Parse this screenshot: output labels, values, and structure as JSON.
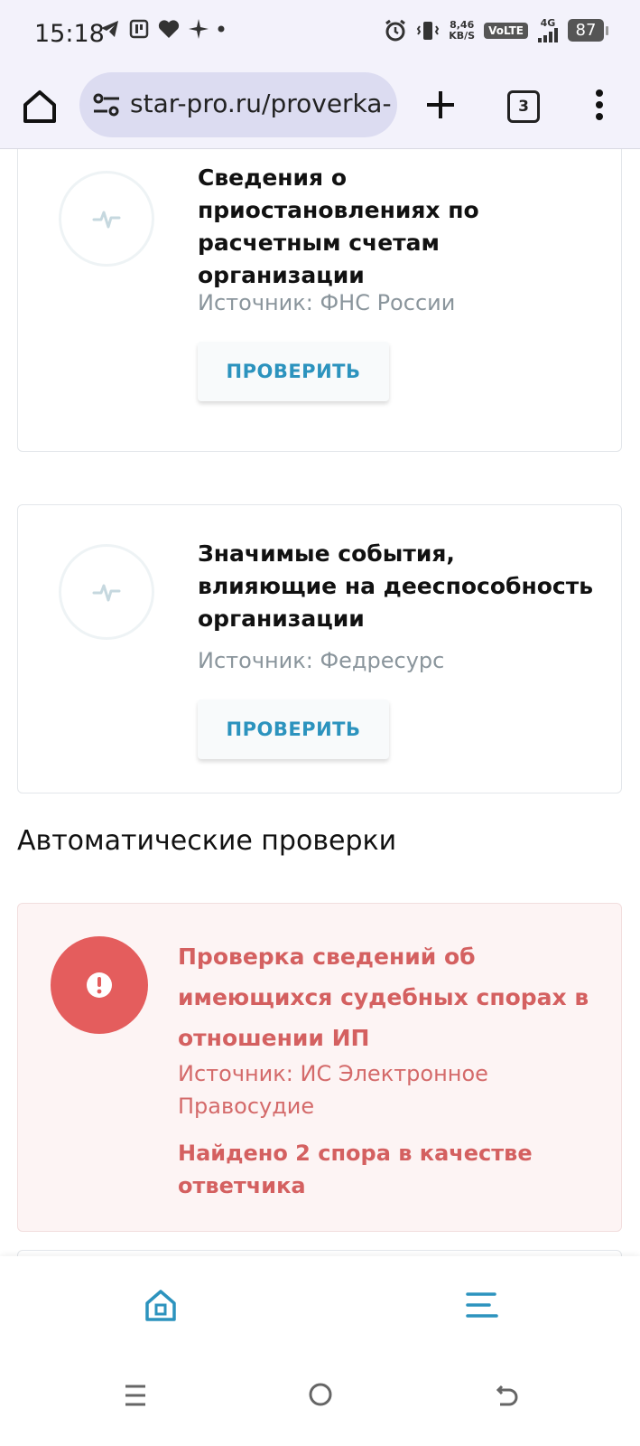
{
  "status_bar": {
    "time": "15:18",
    "net_speed_value": "8,46",
    "net_speed_unit": "KB/S",
    "volte": "VoLTE",
    "signal": "4G",
    "battery": "87"
  },
  "browser": {
    "url": "star-pro.ru/proverka-l",
    "tab_count": "3",
    "icons": {
      "home": "home-icon",
      "site_settings": "site-settings-icon",
      "new_tab": "plus-icon",
      "menu": "kebab-menu-icon"
    }
  },
  "cards": [
    {
      "title": "Сведения о приостановлениях по расчетным счетам организации",
      "source": "Источник: ФНС России",
      "button": "ПРОВЕРИТЬ",
      "icon": "pulse-icon"
    },
    {
      "title": "Значимые события, влияющие на дееспособность организации",
      "source": "Источник: Федресурс",
      "button": "ПРОВЕРИТЬ",
      "icon": "pulse-icon"
    }
  ],
  "section": {
    "title": "Автоматические проверки"
  },
  "alert": {
    "title": "Проверка сведений об имеющихся судебных спорах в отношении ИП",
    "source": "Источник: ИС Электронное Правосудие",
    "result": "Найдено 2 спора в качестве ответчика",
    "icon": "exclamation-icon"
  },
  "bottom_nav": {
    "home_icon": "home-icon",
    "menu_icon": "hamburger-menu-icon"
  },
  "colors": {
    "accent": "#2c93be",
    "alert": "#e45d5d",
    "alert_text": "#d46060",
    "alert_bg": "#fdf4f4",
    "muted": "#8a959c"
  }
}
